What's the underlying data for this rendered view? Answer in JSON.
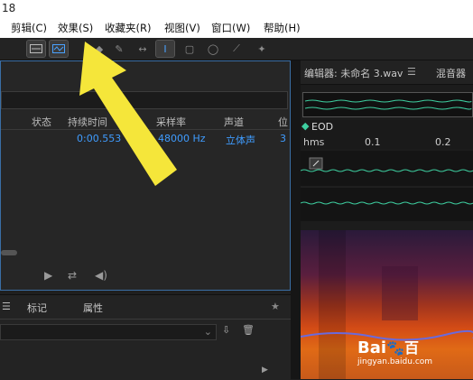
{
  "window": {
    "title": "18"
  },
  "menu": [
    "剪辑(C)",
    "效果(S)",
    "收藏夹(R)",
    "视图(V)",
    "窗口(W)",
    "帮助(H)"
  ],
  "toolbar": {
    "icons": [
      "waveform-view-icon",
      "spectral-view-icon",
      "spot-heal-icon",
      "razor-icon",
      "time-selection-icon",
      "cursor-select-icon",
      "marquee-icon",
      "lasso-icon",
      "brush-icon",
      "spot-healing-brush-icon"
    ]
  },
  "files": {
    "columns": [
      "状态",
      "持续时间",
      "采样率",
      "声道",
      "位"
    ],
    "rows": [
      {
        "duration": "0:00.553",
        "samplerate": "48000 Hz",
        "channels": "立体声",
        "bits": "3"
      }
    ]
  },
  "bottom_panel": {
    "tabs": [
      "标记",
      "属性"
    ]
  },
  "editor": {
    "tab_title": "编辑器: 未命名 3.wav",
    "mixer_tab": "混音器",
    "eod_label": "EOD",
    "ruler_unit": "hms",
    "ruler_ticks": [
      "0.1",
      "0.2"
    ]
  },
  "colors": {
    "accent": "#3f9cff",
    "wave": "#3ecfa0",
    "arrow": "#f5e63a"
  },
  "watermark": {
    "brand": "Bai",
    "brand2": "百",
    "domain": "jingyan.baidu.com"
  }
}
